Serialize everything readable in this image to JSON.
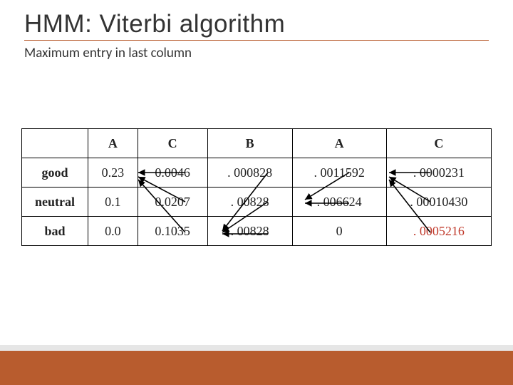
{
  "title": "HMM: Viterbi algorithm",
  "subtitle": "Maximum entry in last column",
  "chart_data": {
    "type": "table",
    "columns": [
      "A",
      "C",
      "B",
      "A",
      "C"
    ],
    "rows": [
      "good",
      "neutral",
      "bad"
    ],
    "cells": {
      "good": [
        "0.23",
        "0.0046",
        ". 000828",
        ". 0011592",
        ". 0000231"
      ],
      "neutral": [
        "0.1",
        "0.0207",
        ". 00828",
        ". 006624",
        ". 00010430"
      ],
      "bad": [
        "0.0",
        "0.1035",
        ". 00828",
        "0",
        ". 0005216"
      ]
    },
    "highlighted_cell": {
      "row": "bad",
      "col": 4
    }
  }
}
